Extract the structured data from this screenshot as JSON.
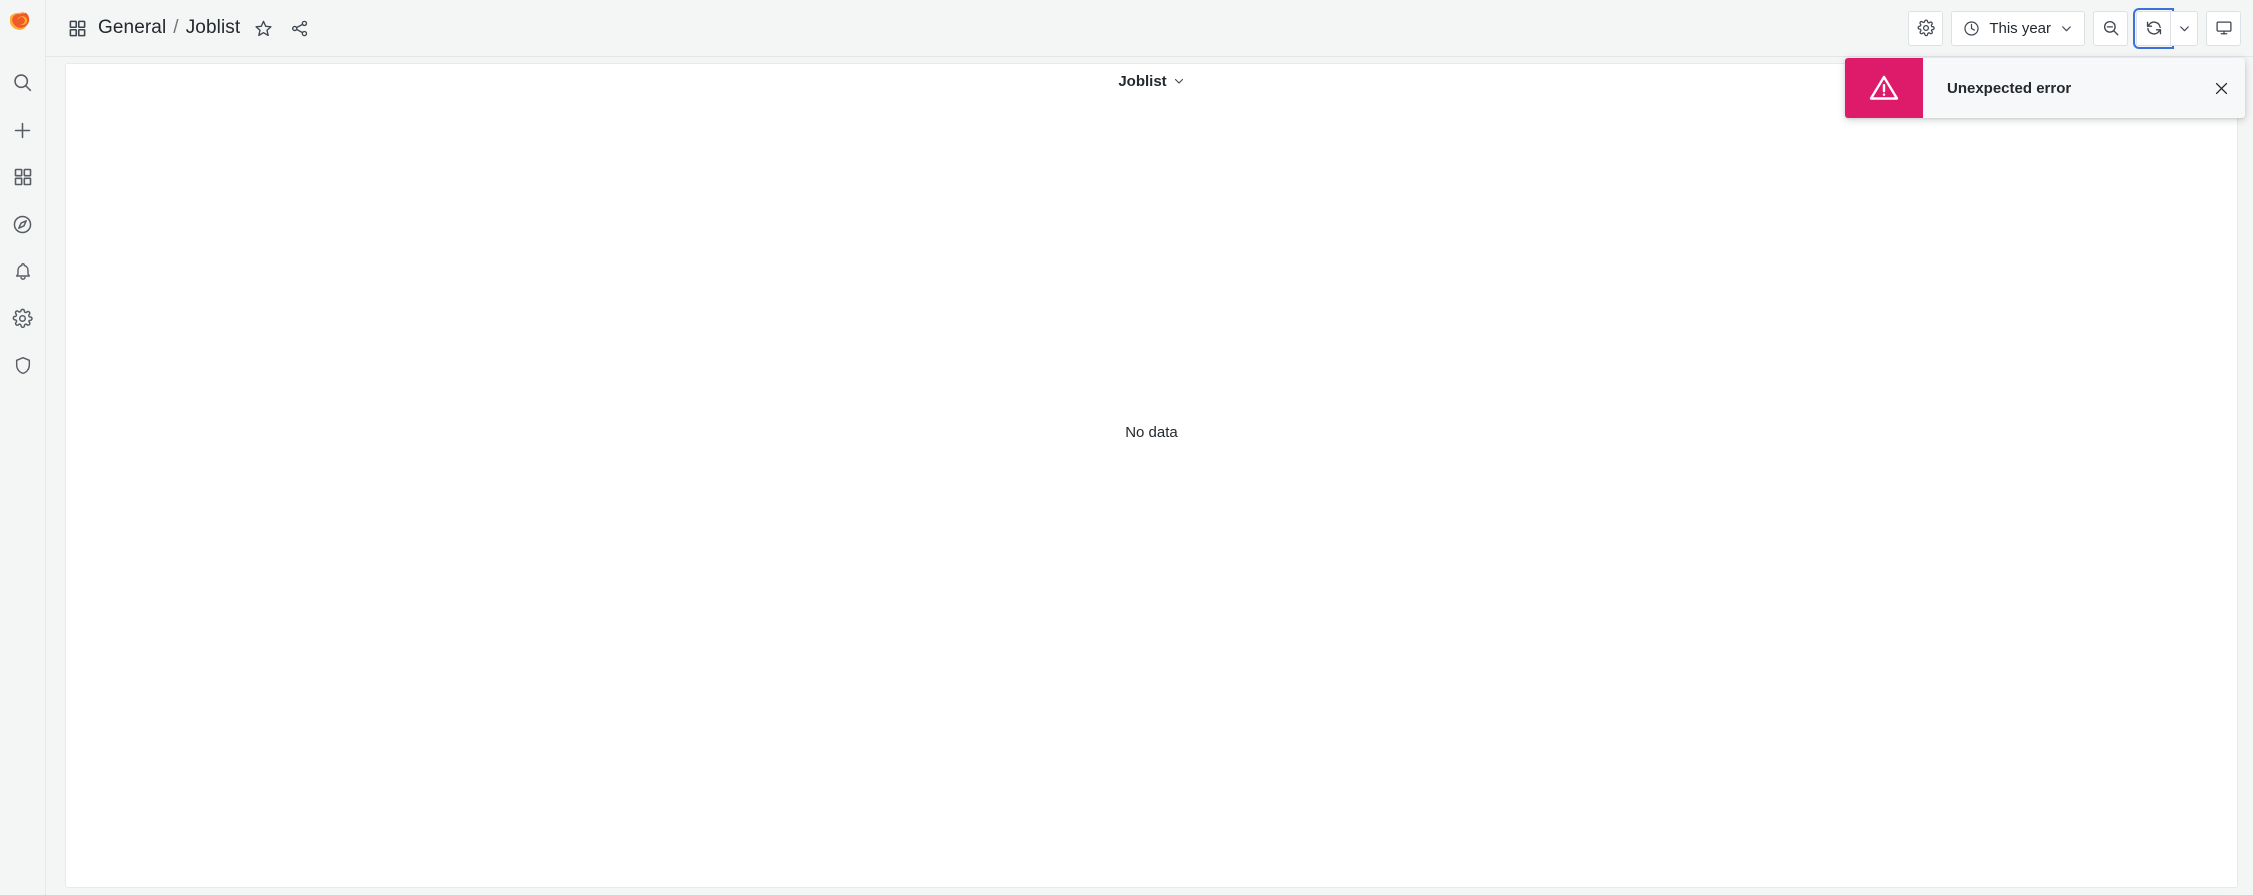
{
  "app": {
    "brand": "grafana-logo",
    "accent_orange": "#F05A28",
    "accent_yellow": "#FBAD37",
    "focus_blue": "#3D71D9",
    "error_pink": "#DE1B6B",
    "page_bg": "#F4F5F5",
    "panel_bg": "#FFFFFF"
  },
  "sidebar": {
    "logo_label": "Grafana",
    "items": [
      {
        "label": "Search",
        "icon": "search-icon"
      },
      {
        "label": "Create",
        "icon": "plus-icon"
      },
      {
        "label": "Dashboards",
        "icon": "dashboards-grid-icon"
      },
      {
        "label": "Explore",
        "icon": "compass-icon"
      },
      {
        "label": "Alerting",
        "icon": "bell-icon"
      },
      {
        "label": "Configuration",
        "icon": "gear-icon"
      },
      {
        "label": "Server Admin",
        "icon": "shield-icon"
      }
    ]
  },
  "header": {
    "breadcrumb": {
      "icon": "dashboards-grid-icon",
      "folder": "General",
      "separator": "/",
      "dashboard": "Joblist"
    },
    "actions": [
      {
        "label": "Mark as favorite",
        "icon": "star-icon"
      },
      {
        "label": "Share dashboard",
        "icon": "share-icon"
      }
    ],
    "toolbar": {
      "settings_label": "Dashboard settings",
      "settings_icon": "gear-icon",
      "time_range": "This year",
      "time_icon": "clock-icon",
      "time_chevron_icon": "chevron-down-icon",
      "zoom_out_label": "Zoom out time range",
      "zoom_out_icon": "zoom-out-icon",
      "refresh_label": "Refresh dashboard",
      "refresh_icon": "refresh-icon",
      "refresh_interval_icon": "chevron-down-icon",
      "kiosk_label": "Cycle view mode",
      "kiosk_icon": "monitor-icon"
    }
  },
  "panel": {
    "title": "Joblist",
    "menu_icon": "chevron-down-icon",
    "empty_state": "No data"
  },
  "toast": {
    "icon": "warning-triangle-icon",
    "message": "Unexpected error",
    "close_icon": "close-icon",
    "close_label": "Close"
  }
}
